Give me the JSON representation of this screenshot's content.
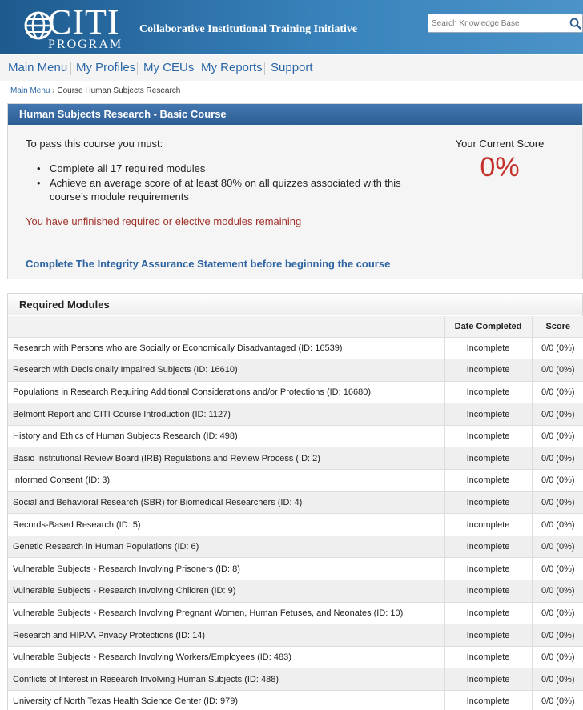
{
  "header": {
    "logo_word": "CITI",
    "logo_sub": "PROGRAM",
    "tagline": "Collaborative Institutional Training Initiative",
    "search_placeholder": "Search Knowledge Base"
  },
  "nav": {
    "items": [
      "Main Menu",
      "My Profiles",
      "My CEUs",
      "My Reports",
      "Support"
    ]
  },
  "breadcrumb": {
    "home": "Main Menu",
    "separator": "›",
    "current": "Course Human Subjects Research"
  },
  "course": {
    "title": "Human Subjects Research - Basic Course",
    "requirements_intro": "To pass this course you must:",
    "requirements": [
      "Complete all 17 required modules",
      "Achieve an average score of at least 80% on all quizzes associated with this course’s module requirements"
    ],
    "warning": "You have unfinished required or elective modules remaining",
    "integrity_link": "Complete The Integrity Assurance Statement before beginning the course",
    "score_label": "Your Current Score",
    "score_value": "0%"
  },
  "modules": {
    "heading": "Required Modules",
    "columns": [
      "",
      "Date Completed",
      "Score"
    ],
    "rows": [
      {
        "name": "Research with Persons who are Socially or Economically Disadvantaged (ID: 16539)",
        "date": "Incomplete",
        "score": "0/0 (0%)"
      },
      {
        "name": "Research with Decisionally Impaired Subjects (ID: 16610)",
        "date": "Incomplete",
        "score": "0/0 (0%)"
      },
      {
        "name": "Populations in Research Requiring Additional Considerations and/or Protections (ID: 16680)",
        "date": "Incomplete",
        "score": "0/0 (0%)"
      },
      {
        "name": "Belmont Report and CITI Course Introduction (ID: 1127)",
        "date": "Incomplete",
        "score": "0/0 (0%)"
      },
      {
        "name": "History and Ethics of Human Subjects Research (ID: 498)",
        "date": "Incomplete",
        "score": "0/0 (0%)"
      },
      {
        "name": "Basic Institutional Review Board (IRB) Regulations and Review Process (ID: 2)",
        "date": "Incomplete",
        "score": "0/0 (0%)"
      },
      {
        "name": "Informed Consent (ID: 3)",
        "date": "Incomplete",
        "score": "0/0 (0%)"
      },
      {
        "name": "Social and Behavioral Research (SBR) for Biomedical Researchers (ID: 4)",
        "date": "Incomplete",
        "score": "0/0 (0%)"
      },
      {
        "name": "Records-Based Research (ID: 5)",
        "date": "Incomplete",
        "score": "0/0 (0%)"
      },
      {
        "name": "Genetic Research in Human Populations (ID: 6)",
        "date": "Incomplete",
        "score": "0/0 (0%)"
      },
      {
        "name": "Vulnerable Subjects - Research Involving Prisoners (ID: 8)",
        "date": "Incomplete",
        "score": "0/0 (0%)"
      },
      {
        "name": "Vulnerable Subjects - Research Involving Children (ID: 9)",
        "date": "Incomplete",
        "score": "0/0 (0%)"
      },
      {
        "name": "Vulnerable Subjects - Research Involving Pregnant Women, Human Fetuses, and Neonates (ID: 10)",
        "date": "Incomplete",
        "score": "0/0 (0%)"
      },
      {
        "name": "Research and HIPAA Privacy Protections (ID: 14)",
        "date": "Incomplete",
        "score": "0/0 (0%)"
      },
      {
        "name": "Vulnerable Subjects - Research Involving Workers/Employees (ID: 483)",
        "date": "Incomplete",
        "score": "0/0 (0%)"
      },
      {
        "name": "Conflicts of Interest in Research Involving Human Subjects (ID: 488)",
        "date": "Incomplete",
        "score": "0/0 (0%)"
      },
      {
        "name": "University of North Texas Health Science Center (ID: 979)",
        "date": "Incomplete",
        "score": "0/0 (0%)"
      }
    ]
  },
  "colors": {
    "header_blue": "#2f74ac",
    "link_blue": "#2a66a6",
    "warning_red": "#a0322a",
    "score_red": "#c3312a"
  },
  "icons": {
    "search": "search-icon",
    "logo": "citi-globe-icon"
  }
}
